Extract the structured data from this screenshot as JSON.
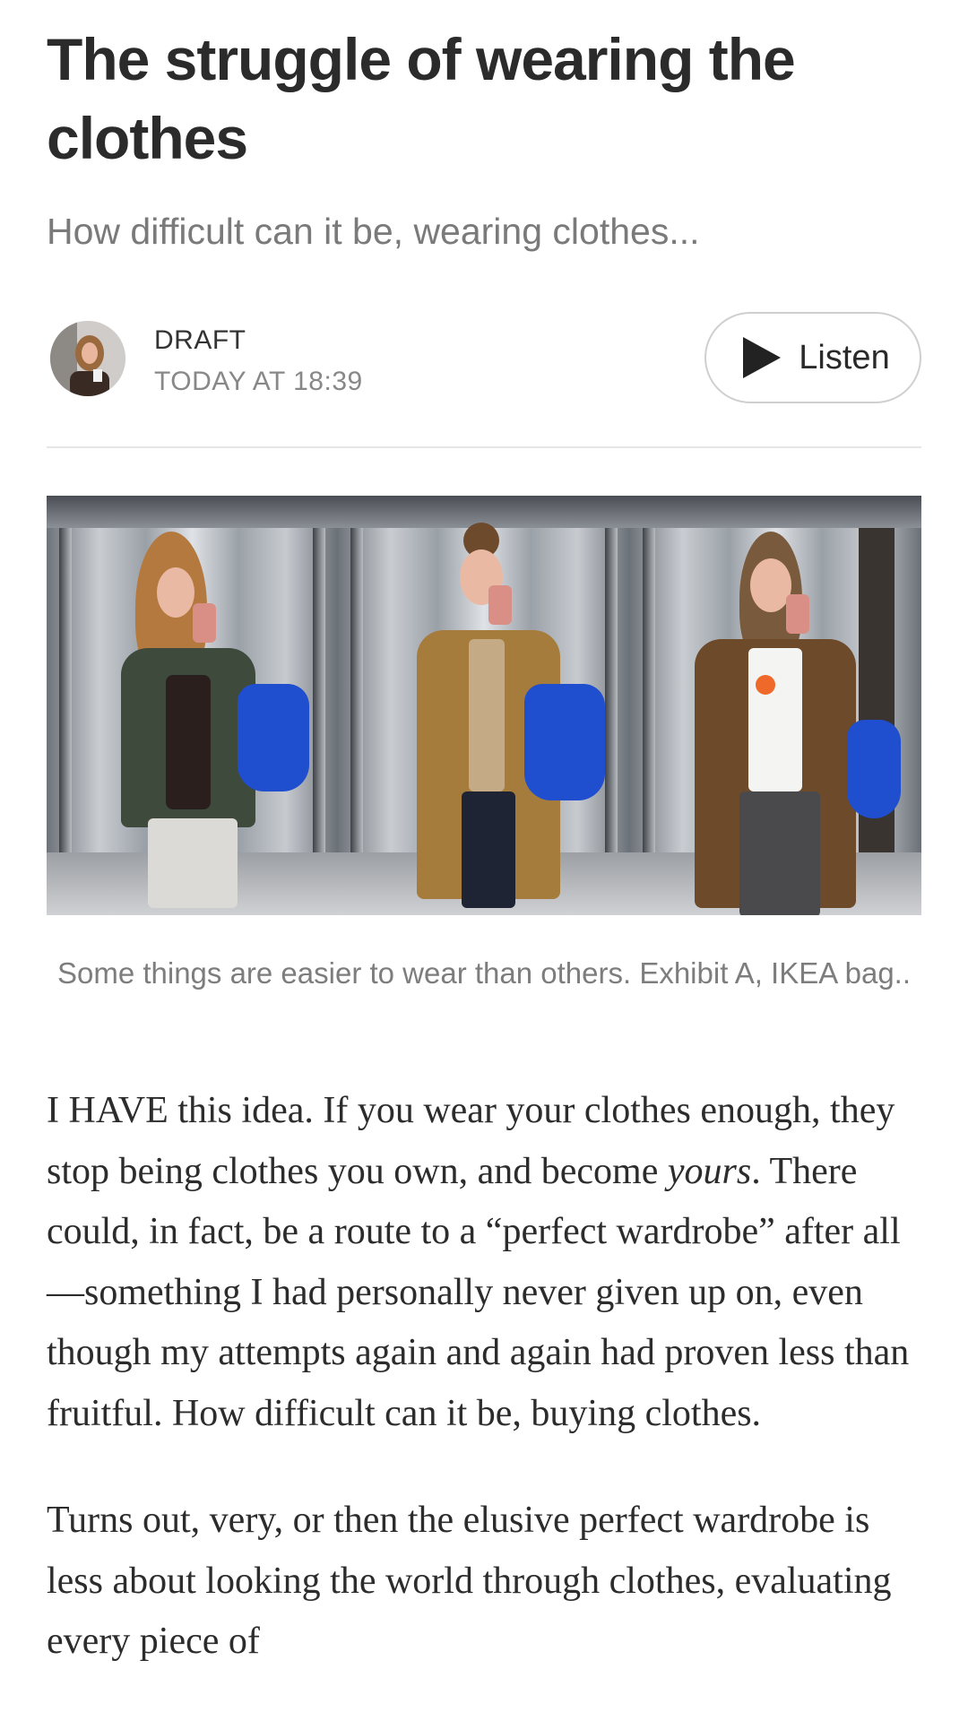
{
  "article": {
    "title": "The struggle of wearing the clothes",
    "subtitle": "How difficult can it be, wearing clothes...",
    "byline": {
      "status": "DRAFT",
      "date": "TODAY AT 18:39",
      "listen_label": "Listen"
    },
    "image_caption": "Some things are easier to wear than others. Exhibit A, IKEA bag..",
    "paragraph1": {
      "part1": "I HAVE this idea. If you wear your clothes enough, they stop being clothes you own, and become ",
      "emphasis": "yours",
      "part2": ". There could, in fact, be a route to a “perfect wardrobe” after all—something I had personally never given up on, even though my attempts again and again had proven less than fruitful. How difficult can it be, buying clothes."
    },
    "paragraph2": "Turns out, very, or then the elusive perfect wardrobe is less about looking the world through clothes, evaluating every piece of"
  },
  "colors": {
    "bag_blue": "#1f4fcf",
    "text_dark": "#2b2b2b",
    "text_muted": "#7a7a7a"
  }
}
